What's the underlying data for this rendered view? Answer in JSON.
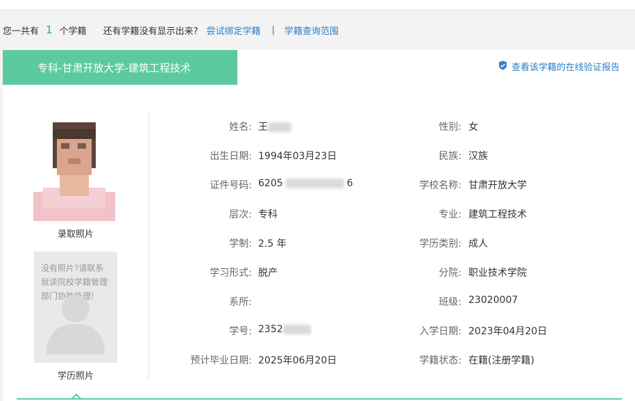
{
  "summary": {
    "prefix": "您一共有",
    "count": "1",
    "suffix": "个学籍",
    "hint": "还有学籍没有显示出来?",
    "bind_link": "尝试绑定学籍",
    "separator": "|",
    "range_link": "学籍查询范围"
  },
  "record": {
    "tab_title": "专科-甘肃开放大学-建筑工程技术",
    "verify_link": "查看该学籍的在线验证报告"
  },
  "photos": {
    "admission_caption": "录取照片",
    "placeholder_text": "没有照片?请联系就读院校学籍管理部门协助处理!",
    "diploma_caption": "学历照片"
  },
  "fields_left": [
    {
      "label": "姓名:",
      "value": "王"
    },
    {
      "label": "出生日期:",
      "value": "1994年03月23日"
    },
    {
      "label": "证件号码:",
      "value_start": "6205",
      "value_end": "6"
    },
    {
      "label": "层次:",
      "value": "专科"
    },
    {
      "label": "学制:",
      "value": "2.5 年"
    },
    {
      "label": "学习形式:",
      "value": "脱产"
    },
    {
      "label": "系所:",
      "value": ""
    },
    {
      "label": "学号:",
      "value": "2352"
    },
    {
      "label": "预计毕业日期:",
      "value": "2025年06月20日"
    }
  ],
  "fields_right": [
    {
      "label": "性别:",
      "value": "女"
    },
    {
      "label": "民族:",
      "value": "汉族"
    },
    {
      "label": "学校名称:",
      "value": "甘肃开放大学"
    },
    {
      "label": "专业:",
      "value": "建筑工程技术"
    },
    {
      "label": "学历类别:",
      "value": "成人"
    },
    {
      "label": "分院:",
      "value": "职业技术学院"
    },
    {
      "label": "班级:",
      "value": "23020007"
    },
    {
      "label": "入学日期:",
      "value": "2023年04月20日"
    },
    {
      "label": "学籍状态:",
      "value": "在籍(注册学籍)"
    }
  ],
  "colors": {
    "accent_green": "#5ccaa0",
    "link_blue": "#2c7fc9"
  },
  "icons": {
    "verify": "shield-check-icon",
    "avatar_placeholder": "person-silhouette-icon"
  }
}
